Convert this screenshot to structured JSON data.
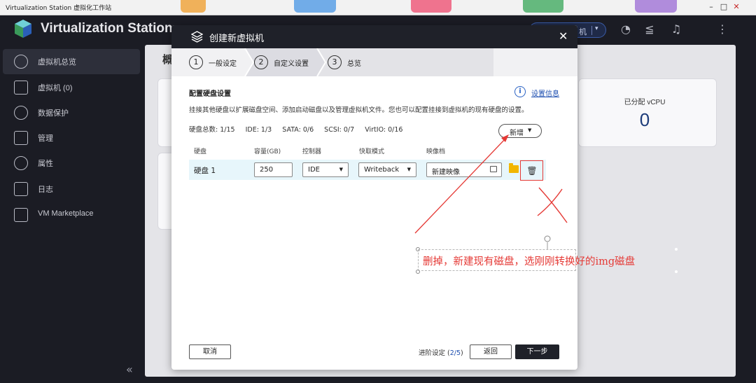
{
  "window": {
    "title": "Virtualization Station 虚拟化工作站",
    "minimize": "–",
    "maximize": "□",
    "close": "✕"
  },
  "header": {
    "app_title": "Virtualization Station",
    "pill_text": "机",
    "pill_caret": "▾",
    "icons": [
      "dashboard-icon",
      "stack-icon",
      "bell-icon",
      "more-icon"
    ]
  },
  "sidebar": {
    "items": [
      {
        "label": "虚拟机总览",
        "icon": "gauge-icon",
        "active": true
      },
      {
        "label": "虚拟机 (0)",
        "icon": "cube-icon",
        "active": false
      },
      {
        "label": "数据保护",
        "icon": "shield-icon",
        "active": false
      },
      {
        "label": "管理",
        "icon": "wrench-icon",
        "active": false
      },
      {
        "label": "属性",
        "icon": "gear-icon",
        "active": false
      },
      {
        "label": "日志",
        "icon": "log-icon",
        "active": false
      },
      {
        "label": "VM Marketplace",
        "icon": "store-icon",
        "active": false
      }
    ],
    "collapse": "«"
  },
  "background": {
    "title": "概",
    "vcpu_label": "已分配 vCPU",
    "vcpu_value": "0"
  },
  "modal": {
    "title": "创建新虚拟机",
    "close": "✕",
    "steps": [
      {
        "num": "1",
        "label": "一般设定",
        "active": false
      },
      {
        "num": "2",
        "label": "自定义设置",
        "active": true
      },
      {
        "num": "3",
        "label": "总览",
        "active": false
      }
    ],
    "section_title": "配置硬盘设置",
    "info_icon": "i",
    "info_link": "设置信息",
    "description": "挂接其他硬盘以扩展磁盘空间、添加启动磁盘以及管理虚拟机文件。您也可以配置挂接到虚拟机的现有硬盘的设置。",
    "stats": {
      "total": "硬盘总数: 1/15",
      "ide": "IDE: 1/3",
      "sata": "SATA: 0/6",
      "scsi": "SCSI: 0/7",
      "virtio": "VirtIO: 0/16"
    },
    "add_button": "新增",
    "add_caret": "▼",
    "columns": [
      "硬盘",
      "容量(GB)",
      "控制器",
      "快取模式",
      "映像档"
    ],
    "disk": {
      "name": "硬盘 1",
      "capacity": "250",
      "controller": "IDE",
      "cache_mode": "Writeback",
      "image": "新建映像",
      "dropdown_caret": "▼",
      "trash": "🗑"
    },
    "footer": {
      "cancel": "取消",
      "advanced_prefix": "进阶设定 (",
      "advanced_num": "2/5",
      "advanced_suffix": ")",
      "back": "返回",
      "next": "下一步"
    }
  },
  "annotation": {
    "note": "删掉，新建现有磁盘，选刚刚转换好的img磁盘",
    "color": "#e53935"
  },
  "colors": {
    "app_bg": "#1b1c24",
    "modal_header": "#1f2129",
    "row_highlight": "#e7f6fb",
    "link_blue": "#1e4fb0",
    "vcpu_blue": "#1d3c7a"
  }
}
